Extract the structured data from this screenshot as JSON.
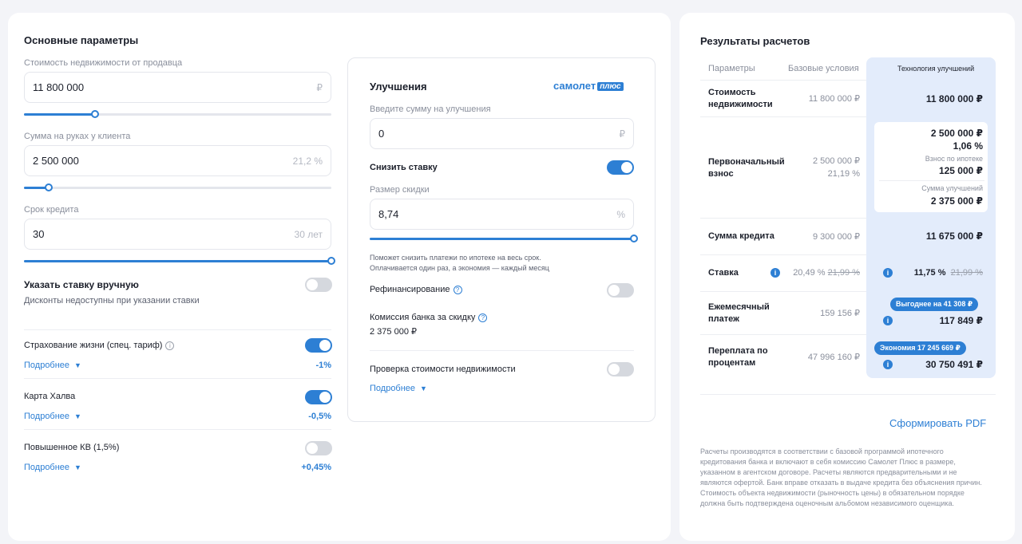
{
  "params": {
    "title": "Основные параметры",
    "price": {
      "label": "Стоимость недвижимости от продавца",
      "value": "11 800 000",
      "suffix": "₽",
      "slider_fraction": 0.23
    },
    "cash": {
      "label": "Сумма на руках у клиента",
      "value": "2 500 000",
      "suffix": "21,2 %",
      "slider_fraction": 0.08
    },
    "term": {
      "label": "Срок кредита",
      "value": "30",
      "suffix": "30 лет",
      "slider_fraction": 1.0
    },
    "manual_rate": {
      "label": "Указать ставку вручную",
      "hint": "Дисконты недоступны при указании ставки",
      "enabled": false
    },
    "options": [
      {
        "label": "Страхование жизни (спец. тариф)",
        "link": "Подробнее",
        "discount": "-1%",
        "enabled": true
      },
      {
        "label": "Карта Халва",
        "link": "Подробнее",
        "discount": "-0,5%",
        "enabled": true
      },
      {
        "label": "Повышенное КВ (1,5%)",
        "link": "Подробнее",
        "discount": "+0,45%",
        "enabled": false
      }
    ]
  },
  "improvements": {
    "title": "Улучшения",
    "brand": "самолет",
    "brand_plus": "плюс",
    "amount": {
      "label": "Введите сумму на улучшения",
      "value": "0",
      "suffix": "₽"
    },
    "lower_rate": {
      "label": "Снизить ставку",
      "enabled": true
    },
    "discount": {
      "label": "Размер скидки",
      "value": "8,74",
      "suffix": "%",
      "slider_fraction": 1.0
    },
    "hint_line1": "Поможет снизить платежи по ипотеке на весь срок.",
    "hint_line2": "Оплачивается один раз, а экономия — каждый месяц",
    "refinancing": {
      "label": "Рефинансирование",
      "enabled": false
    },
    "commission": {
      "label": "Комиссия банка за скидку",
      "value": "2 375 000 ₽"
    },
    "check_price": {
      "label": "Проверка стоимости недвижимости",
      "link": "Подробнее",
      "enabled": false
    }
  },
  "results": {
    "title": "Результаты расчетов",
    "headers": {
      "params": "Параметры",
      "base": "Базовые условия",
      "tech": "Технология улучшений"
    },
    "price": {
      "label_1": "Стоимость",
      "label_2": "недвижимости",
      "base": "11 800 000 ₽",
      "tech": "11 800 000 ₽"
    },
    "down_payment": {
      "label_1": "Первоначальный",
      "label_2": "взнос",
      "base_amount": "2 500 000 ₽",
      "base_percent": "21,19 %",
      "tech_amount": "2 500 000 ₽",
      "tech_percent": "1,06 %",
      "mortgage_fee_label": "Взнос по ипотеке",
      "mortgage_fee": "125 000 ₽",
      "improvements_label": "Сумма улучшений",
      "improvements": "2 375 000 ₽"
    },
    "loan": {
      "label": "Сумма кредита",
      "base": "9 300 000 ₽",
      "tech": "11 675 000 ₽"
    },
    "rate": {
      "label": "Ставка",
      "base": "20,49 %",
      "base_old": "21,99 %",
      "tech": "11,75 %",
      "tech_old": "21,99 %"
    },
    "monthly": {
      "label_1": "Ежемесячный",
      "label_2": "платеж",
      "base": "159 156 ₽",
      "badge": "Выгоднее на 41 308 ₽",
      "tech": "117 849 ₽"
    },
    "overpay": {
      "label_1": "Переплата по",
      "label_2": "процентам",
      "base": "47 996 160 ₽",
      "badge": "Экономия 17 245 669 ₽",
      "tech": "30 750 491 ₽"
    },
    "pdf_button": "Сформировать PDF",
    "disclaimer": "Расчеты производятся в соответствии с базовой программой ипотечного кредитования банка и включают в себя комиссию Самолет Плюс в размере, указанном в агентском договоре. Расчеты являются предварительными и не являются офертой. Банк вправе отказать в выдаче кредита без объяснения причин. Стоимость объекта недвижимости (рыночность цены) в обязательном порядке должна быть подтверждена оценочным альбомом независимого оценщика."
  },
  "colors": {
    "accent": "#2d7fd4",
    "tech_column": "#e3ecfb",
    "background": "#f3f4f8"
  },
  "icons": [
    "info-icon",
    "question-icon",
    "chevron-down-icon",
    "ruble-icon"
  ]
}
